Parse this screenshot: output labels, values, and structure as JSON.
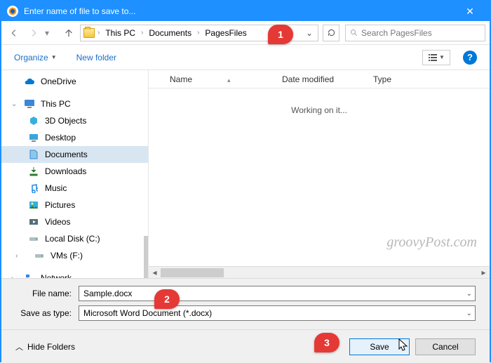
{
  "window": {
    "title": "Enter name of file to save to...",
    "close_glyph": "✕"
  },
  "nav": {
    "breadcrumbs": [
      "This PC",
      "Documents",
      "PagesFiles"
    ],
    "search_placeholder": "Search PagesFiles"
  },
  "toolbar": {
    "organize": "Organize",
    "new_folder": "New folder",
    "help_glyph": "?"
  },
  "columns": {
    "name": "Name",
    "date": "Date modified",
    "type": "Type"
  },
  "status_text": "Working on it...",
  "sidebar": {
    "onedrive": "OneDrive",
    "thispc": "This PC",
    "items": [
      {
        "label": "3D Objects"
      },
      {
        "label": "Desktop"
      },
      {
        "label": "Documents"
      },
      {
        "label": "Downloads"
      },
      {
        "label": "Music"
      },
      {
        "label": "Pictures"
      },
      {
        "label": "Videos"
      },
      {
        "label": "Local Disk (C:)"
      },
      {
        "label": "VMs (F:)"
      }
    ],
    "network": "Network"
  },
  "form": {
    "filename_label": "File name:",
    "filename_value": "Sample.docx",
    "saveas_label": "Save as type:",
    "saveas_value": "Microsoft Word Document (*.docx)"
  },
  "footer": {
    "hide_folders": "Hide Folders",
    "save": "Save",
    "cancel": "Cancel"
  },
  "watermark": "groovyPost.com",
  "annotations": {
    "a1": "1",
    "a2": "2",
    "a3": "3"
  }
}
